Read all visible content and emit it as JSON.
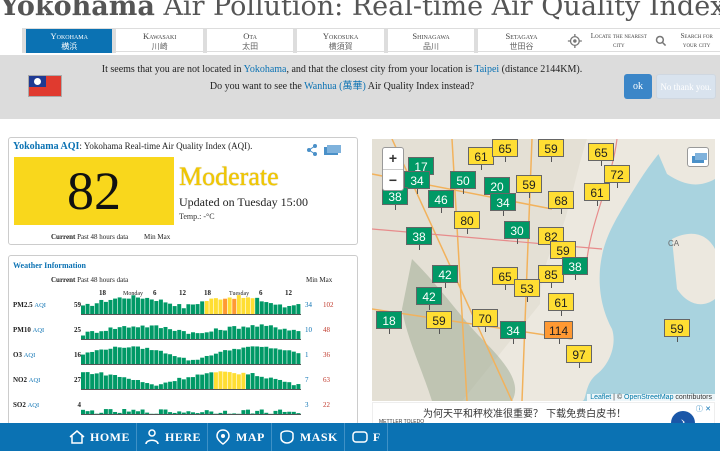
{
  "header": {
    "title_city": "Yokohama",
    "title_rest": "Air Pollution: Real-time Air Quality Index (AQI)"
  },
  "city_nav": [
    {
      "name": "Yokohama",
      "zh": "横浜",
      "selected": true
    },
    {
      "name": "Kawasaki",
      "zh": "川崎"
    },
    {
      "name": "Ota",
      "zh": "太田"
    },
    {
      "name": "Yokosuka",
      "zh": "横須賀"
    },
    {
      "name": "Shinagawa",
      "zh": "品川"
    },
    {
      "name": "Setagaya",
      "zh": "世田谷"
    }
  ],
  "nav_tools": {
    "locate": "Locate the nearest city",
    "search": "Search for your city"
  },
  "location_banner": {
    "msg_1": "It seems that you are not located in",
    "city_link": "Yokohama",
    "msg_2": ", and that the closest city from your location is",
    "closest": "Taipei",
    "msg_3": "(distance 2144KM).",
    "msg_4": "Do you want to see the",
    "alt_link": "Wanhua (萬華)",
    "msg_5": "Air Quality Index instead?",
    "ok_label": "ok",
    "no_label": "No thank you."
  },
  "aqi_card": {
    "head_link": "Yokohama AQI",
    "head_rest": ": Yokohama Real-time Air Quality Index (AQI).",
    "aqi_value": "82",
    "level": "Moderate",
    "updated": "Updated on Tuesday 15:00",
    "temp": "Temp.: -°C",
    "tab_current": "Current",
    "tab_past": "Past 48 hours data",
    "tab_minmax": "Min Max",
    "level_color": "#f9d71c"
  },
  "weather_card": {
    "title": "Weather Information",
    "hdr_current": "Current",
    "hdr_past": "Past 48 hours data",
    "hdr_minmax": "Min Max",
    "axis_labels": [
      "18",
      "Monday",
      "6",
      "12",
      "18",
      "Tuesday",
      "6",
      "12"
    ],
    "rows": [
      {
        "name": "PM2.5",
        "sub": "AQI",
        "current": "59",
        "min": "34",
        "max": "102"
      },
      {
        "name": "PM10",
        "sub": "AQI",
        "current": "25",
        "min": "10",
        "max": "48"
      },
      {
        "name": "O3",
        "sub": "AQI",
        "current": "16",
        "min": "1",
        "max": "36"
      },
      {
        "name": "NO2",
        "sub": "AQI",
        "current": "27",
        "min": "7",
        "max": "63"
      },
      {
        "name": "SO2",
        "sub": "AQI",
        "current": "4",
        "min": "3",
        "max": "22"
      }
    ]
  },
  "map": {
    "markers": [
      {
        "v": "17",
        "c": "g"
      },
      {
        "v": "61",
        "c": "y"
      },
      {
        "v": "65",
        "c": "y"
      },
      {
        "v": "59",
        "c": "y"
      },
      {
        "v": "65",
        "c": "y"
      },
      {
        "v": "34",
        "c": "g"
      },
      {
        "v": "50",
        "c": "g"
      },
      {
        "v": "20",
        "c": "g"
      },
      {
        "v": "59",
        "c": "y"
      },
      {
        "v": "72",
        "c": "y"
      },
      {
        "v": "61",
        "c": "y"
      },
      {
        "v": "38",
        "c": "g"
      },
      {
        "v": "46",
        "c": "g"
      },
      {
        "v": "34",
        "c": "g"
      },
      {
        "v": "68",
        "c": "y"
      },
      {
        "v": "80",
        "c": "y"
      },
      {
        "v": "30",
        "c": "g"
      },
      {
        "v": "38",
        "c": "g"
      },
      {
        "v": "82",
        "c": "y"
      },
      {
        "v": "59",
        "c": "y"
      },
      {
        "v": "42",
        "c": "g"
      },
      {
        "v": "65",
        "c": "y"
      },
      {
        "v": "85",
        "c": "y"
      },
      {
        "v": "38",
        "c": "g"
      },
      {
        "v": "42",
        "c": "g"
      },
      {
        "v": "53",
        "c": "y"
      },
      {
        "v": "61",
        "c": "y"
      },
      {
        "v": "18",
        "c": "g"
      },
      {
        "v": "59",
        "c": "y"
      },
      {
        "v": "70",
        "c": "y"
      },
      {
        "v": "34",
        "c": "g"
      },
      {
        "v": "114",
        "c": "o"
      },
      {
        "v": "59",
        "c": "y"
      },
      {
        "v": "97",
        "c": "y"
      }
    ],
    "zoom_in": "+",
    "zoom_out": "−",
    "attr_leaflet": "Leaflet",
    "attr_sep": " | © ",
    "attr_osm": "OpenStreetMap",
    "attr_rest": " contributors"
  },
  "ad": {
    "logo": "METTLER TOLEDO",
    "text": "为何天平和秤校准很重要？ 下载免费白皮书！",
    "close": "ⓘ ✕"
  },
  "bottom_nav": [
    "HOME",
    "HERE",
    "MAP",
    "MASK",
    "F"
  ]
}
